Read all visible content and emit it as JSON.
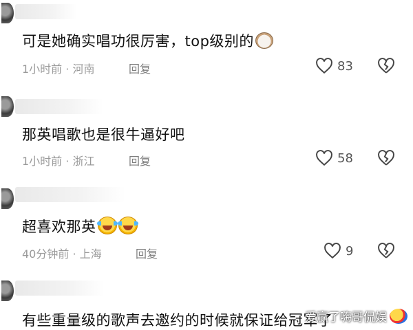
{
  "comments": [
    {
      "text": "可是她确实唱功很厉害，top级别的",
      "emoji": "cat-face",
      "time": "1小时前",
      "location": "河南",
      "reply_label": "回复",
      "likes": "83"
    },
    {
      "text": "那英唱歌也是很牛逼好吧",
      "time": "1小时前",
      "location": "浙江",
      "reply_label": "回复",
      "likes": "58"
    },
    {
      "text": "超喜欢那英",
      "emoji": "laugh-cry x2",
      "time": "40分钟前",
      "location": "上海",
      "reply_label": "回复",
      "likes": "9"
    },
    {
      "text": "有些重量级的歌声去邀约的时候就保证给冠军了"
    }
  ],
  "meta_separator": "·",
  "watermark": "爱赢了嗨哥侃娱",
  "colors": {
    "meta": "#9a9a9a",
    "icon": "#444444"
  },
  "icons": {
    "like": "heart-outline-icon",
    "dislike": "broken-heart-icon"
  }
}
